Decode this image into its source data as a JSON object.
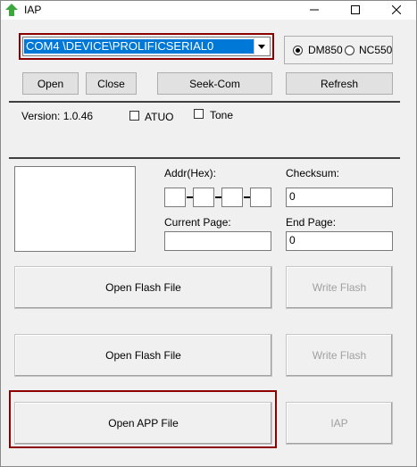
{
  "window": {
    "title": "IAP",
    "controls": [
      "minimize-icon",
      "maximize-icon",
      "close-icon"
    ]
  },
  "com_port": {
    "selected": "COM4  \\DEVICE\\PROLIFICSERIAL0"
  },
  "device_type": {
    "options": [
      {
        "label": "DM850",
        "checked": true
      },
      {
        "label": "NC550",
        "checked": false
      }
    ]
  },
  "toolbar": {
    "open": "Open",
    "close": "Close",
    "seek_com": "Seek-Com",
    "refresh": "Refresh"
  },
  "version": {
    "text": "Version:  1.0.46"
  },
  "options": {
    "atuo": {
      "label": "ATUO",
      "checked": false
    },
    "tone": {
      "label": "Tone",
      "checked": false
    }
  },
  "fields": {
    "addr_label": "Addr(Hex):",
    "checksum_label": "Checksum:",
    "checksum_value": "0",
    "current_page_label": "Current Page:",
    "current_page_value": "",
    "end_page_label": "End Page:",
    "end_page_value": "0"
  },
  "actions": {
    "open_flash_1": "Open Flash File",
    "write_flash_1": "Write Flash",
    "open_flash_2": "Open Flash File",
    "write_flash_2": "Write Flash",
    "open_app": "Open APP File",
    "iap": "IAP"
  },
  "colors": {
    "selection": "#0078d7",
    "highlight_border": "#8b0000",
    "app_icon": "#3aa83a"
  }
}
